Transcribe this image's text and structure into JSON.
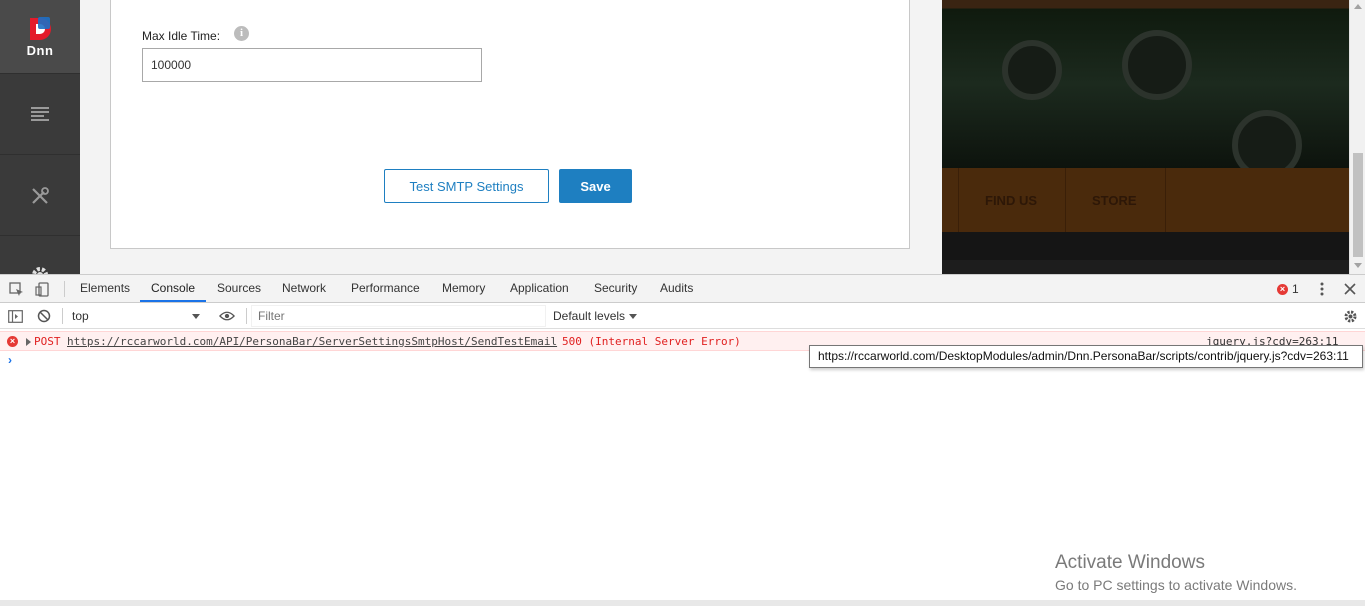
{
  "persona_bar": {
    "logo_text": "Dnn",
    "items": [
      {
        "icon": "content-icon"
      },
      {
        "icon": "tools-icon"
      },
      {
        "icon": "gear-icon"
      }
    ]
  },
  "form": {
    "idle_label": "Max Idle Time:",
    "idle_value": "100000",
    "test_button": "Test SMTP Settings",
    "save_button": "Save"
  },
  "site_preview": {
    "nav_items": [
      "FIND US",
      "STORE"
    ]
  },
  "devtools": {
    "tabs": [
      "Elements",
      "Console",
      "Sources",
      "Network",
      "Performance",
      "Memory",
      "Application",
      "Security",
      "Audits"
    ],
    "active_tab": "Console",
    "error_count": "1",
    "context": "top",
    "filter_placeholder": "Filter",
    "levels": "Default levels",
    "error": {
      "method": "POST",
      "url": "https://rccarworld.com/API/PersonaBar/ServerSettingsSmtpHost/SendTestEmail",
      "status": "500 (Internal Server Error)",
      "source": "jquery.js?cdv=263:11"
    },
    "tooltip": "https://rccarworld.com/DesktopModules/admin/Dnn.PersonaBar/scripts/contrib/jquery.js?cdv=263:11",
    "colors": {
      "accent": "#1a73e8",
      "error": "#e02020"
    }
  },
  "watermark": {
    "title": "Activate Windows",
    "subtitle": "Go to PC settings to activate Windows."
  },
  "colors": {
    "primary": "#1e7fc1",
    "sidebar": "#3a3a3a"
  }
}
